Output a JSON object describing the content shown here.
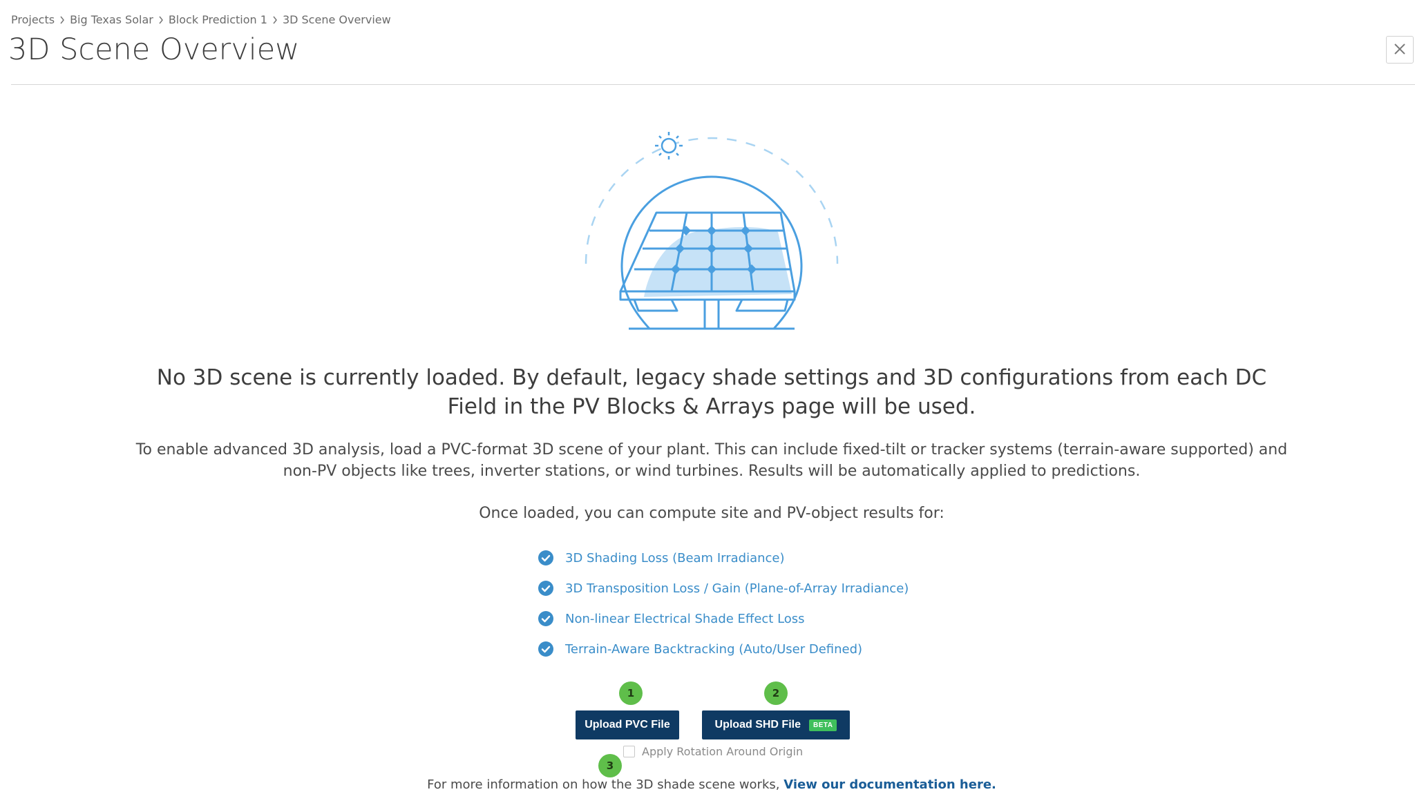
{
  "breadcrumb": {
    "items": [
      "Projects",
      "Big Texas Solar",
      "Block Prediction 1",
      "3D Scene Overview"
    ]
  },
  "header": {
    "title": "3D Scene Overview",
    "close_icon": "close-icon"
  },
  "illustration": {
    "icon": "solar-panel-sun-illustration",
    "color": "#4a9fe0"
  },
  "main": {
    "headline": "No 3D scene is currently loaded. By default, legacy shade settings and 3D configurations from each DC Field in the PV Blocks & Arrays page will be used.",
    "description": "To enable advanced 3D analysis, load a PVC-format 3D scene of your plant. This can include fixed-tilt or tracker systems (terrain-aware supported) and non-PV objects like trees, inverter stations, or wind turbines. Results will be automatically applied to predictions.",
    "subhead": "Once loaded, you can compute site and PV-object results for:",
    "features": [
      "3D Shading Loss (Beam Irradiance)",
      "3D Transposition Loss / Gain (Plane-of-Array Irradiance)",
      "Non-linear Electrical Shade Effect Loss",
      "Terrain-Aware Backtracking (Auto/User Defined)"
    ]
  },
  "actions": {
    "step_1": "1",
    "step_2": "2",
    "step_3": "3",
    "upload_pvc_label": "Upload PVC File",
    "upload_shd_label": "Upload SHD File",
    "beta_badge": "BETA",
    "apply_rotation_label": "Apply Rotation Around Origin",
    "apply_rotation_checked": false
  },
  "footer": {
    "text": "For more information on how the 3D shade scene works,",
    "link_text": "View our documentation here."
  },
  "colors": {
    "primary_button": "#0f3a63",
    "accent_blue": "#3a8dc9",
    "step_badge_green": "#5fbe4a",
    "beta_green": "#3fbf5c"
  }
}
